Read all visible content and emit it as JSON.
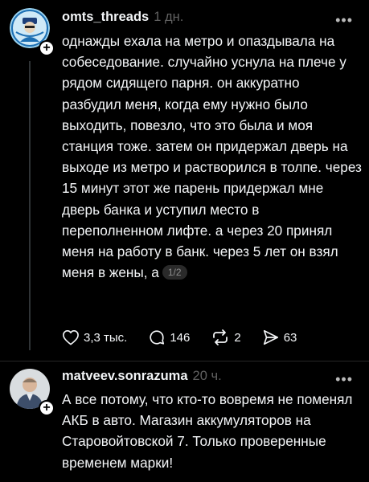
{
  "post1": {
    "username": "omts_threads",
    "time": "1 дн.",
    "text": "однажды ехала на метро и опаздывала на собеседование. случайно уснула на плече у рядом сидящего парня. он аккуратно разбудил меня, когда ему нужно было выходить, повезло, что это была и моя станция тоже. затем он придержал дверь на выходе из метро и растворился в толпе. через 15 минут этот же парень придержал мне дверь банка и уступил место в переполненном лифте. а через 20 принял меня на работу в банк. через 5 лет он взял меня в жены, а",
    "pager": "1/2",
    "likes": "3,3 тыс.",
    "comments": "146",
    "reposts": "2",
    "shares": "63"
  },
  "post2": {
    "username": "matveev.sonrazuma",
    "time": "20 ч.",
    "text": "А все потому, что кто-то вовремя не поменял АКБ в авто. Магазин аккумуляторов на Старовойтовской 7. Только проверенные временем марки!"
  },
  "icons": {
    "more": "more-icon",
    "like": "heart-icon",
    "comment": "comment-icon",
    "repost": "repost-icon",
    "share": "send-icon",
    "follow": "plus-icon"
  },
  "colors": {
    "background": "#000000",
    "text": "#f3f5f7",
    "muted": "#616161",
    "thread_line": "#2f3336"
  }
}
